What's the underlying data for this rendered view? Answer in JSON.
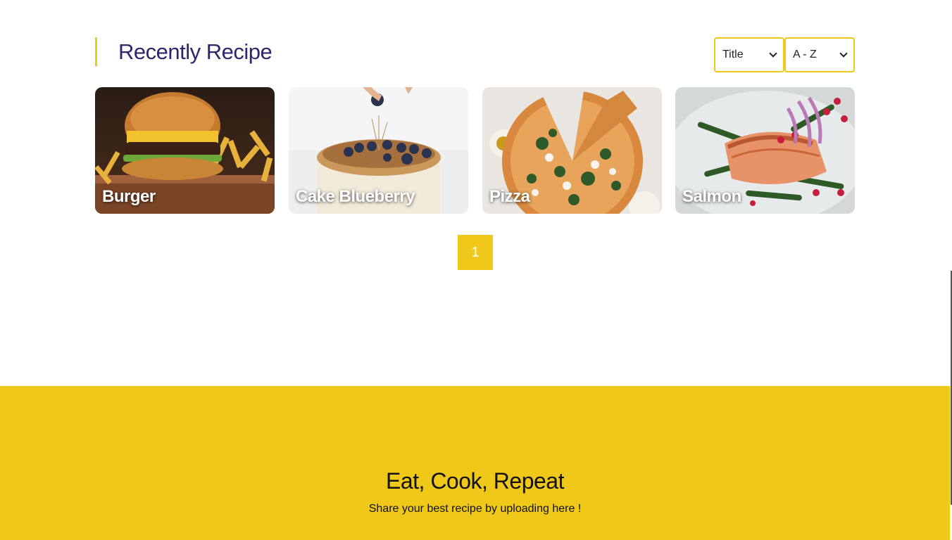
{
  "section": {
    "title": "Recently Recipe"
  },
  "sort": {
    "field": {
      "value": "Title",
      "options": [
        "Title"
      ]
    },
    "order": {
      "value": "A - Z",
      "options": [
        "A - Z"
      ]
    }
  },
  "recipes": [
    {
      "name": "Burger",
      "image": "burger-photo"
    },
    {
      "name": "Cake Blueberry",
      "image": "cake-photo"
    },
    {
      "name": "Pizza",
      "image": "pizza-photo"
    },
    {
      "name": "Salmon",
      "image": "salmon-photo"
    }
  ],
  "pagination": {
    "current": "1"
  },
  "footer": {
    "title": "Eat, Cook, Repeat",
    "subtitle": "Share your best recipe by uploading here !"
  },
  "colors": {
    "accent": "#EFC81A",
    "title": "#2E266F"
  }
}
